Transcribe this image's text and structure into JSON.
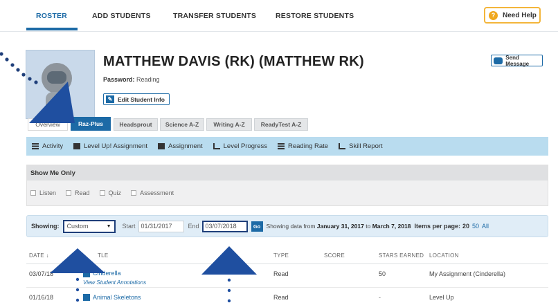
{
  "nav": {
    "tabs": [
      "ROSTER",
      "ADD STUDENTS",
      "TRANSFER STUDENTS",
      "RESTORE STUDENTS"
    ],
    "help_label": "Need Help",
    "help_glyph": "?"
  },
  "student": {
    "name": "MATTHEW DAVIS (RK) (MATTHEW RK)",
    "password_label": "Password:",
    "password_value": "Reading",
    "edit_label": "Edit Student Info",
    "message_label": "Send Message"
  },
  "product_tabs": [
    "Overview",
    "Raz-Plus",
    "Headsprout",
    "Science A-Z",
    "Writing A-Z",
    "ReadyTest A-Z"
  ],
  "sub_nav": [
    "Activity",
    "Level Up! Assignment",
    "Assignment",
    "Level Progress",
    "Reading Rate",
    "Skill Report"
  ],
  "filter": {
    "title": "Show Me Only",
    "options": [
      "Listen",
      "Read",
      "Quiz",
      "Assessment"
    ]
  },
  "showing": {
    "label": "Showing:",
    "select_value": "Custom",
    "start_label": "Start",
    "start_value": "01/31/2017",
    "end_label": "End",
    "end_value": "03/07/2018",
    "go_label": "Go",
    "info_prefix": "Showing data from",
    "info_from": "January 31, 2017",
    "info_to_word": "to",
    "info_to": "March 7, 2018",
    "ipp_label": "Items per page:",
    "ipp_current": "20",
    "ipp_options": [
      "50",
      "All"
    ]
  },
  "table": {
    "headers": [
      "DATE ↓",
      "TLE",
      "TYPE",
      "SCORE",
      "STARS EARNED",
      "LOCATION"
    ],
    "rows": [
      {
        "date": "03/07/18",
        "title": "Cinderella",
        "sub": "View Student Annotations",
        "type": "Read",
        "score": "",
        "stars": "50",
        "location": "My Assignment (Cinderella)"
      },
      {
        "date": "01/16/18",
        "title": "Animal Skeletons",
        "sub": "",
        "type": "Read",
        "score": "",
        "stars": "-",
        "location": "Level Up"
      }
    ]
  },
  "colors": {
    "brand_blue": "#1c6aa6",
    "annotation_navy": "#1f3f7a",
    "help_accent": "#f0a81e"
  }
}
